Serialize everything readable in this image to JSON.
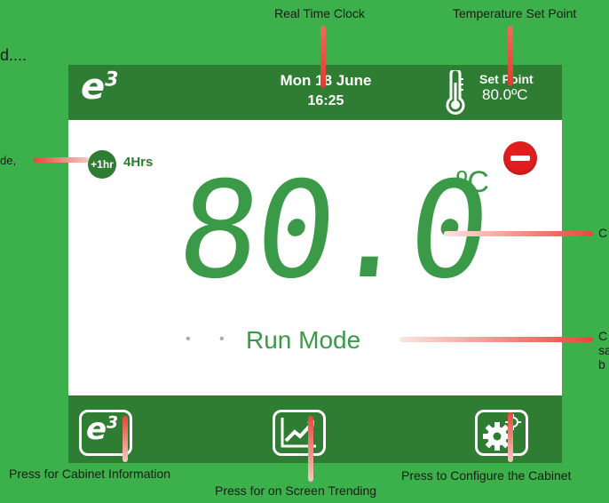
{
  "callouts": {
    "real_time_clock": "Real Time Clock",
    "temperature_set_point": "Temperature Set Point",
    "partial_left_top": "d....",
    "partial_left_mode": "de,",
    "partial_right_c1": "C",
    "partial_right_c2": "C",
    "partial_right_sa": "sa",
    "partial_right_b": "b",
    "cabinet_information": "Press for Cabinet Information",
    "screen_trending": "Press for on Screen Trending",
    "configure_cabinet": "Press to Configure the Cabinet"
  },
  "header": {
    "logo": "e",
    "logo_sup": "3",
    "date": "Mon 18 June",
    "time": "16:25",
    "set_point_label": "Set Point",
    "set_point_value": "80.0ºC"
  },
  "main": {
    "boost_badge": "+1hr",
    "boost_hours": "4Hrs",
    "temperature": "80.0",
    "unit": "ºC",
    "mode": "Run Mode",
    "status_color": "#e01e1e"
  },
  "footer": {
    "info_logo": "e",
    "info_logo_sup": "3"
  },
  "icons": [
    "thermometer-icon",
    "trending-chart-icon",
    "settings-gear-icon",
    "stop-status-icon"
  ],
  "colors": {
    "background": "#3cb04a",
    "bar": "#2e7d32",
    "digits": "#3a9a48",
    "accent_red": "#e23b2e"
  }
}
